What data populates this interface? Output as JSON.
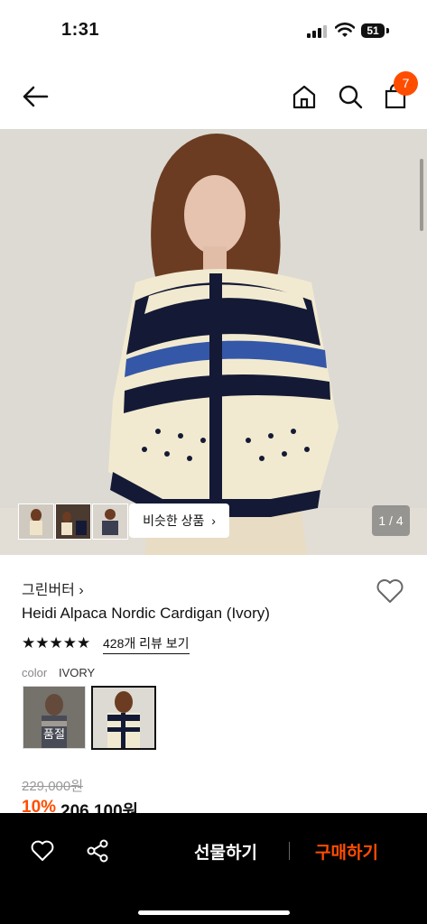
{
  "status_bar": {
    "time": "1:31",
    "battery": "51"
  },
  "header": {
    "cart_count": "7"
  },
  "gallery": {
    "similar_label": "비슷한 상품",
    "page_counter": "1 / 4"
  },
  "product": {
    "brand": "그린버터",
    "name": "Heidi Alpaca Nordic Cardigan (Ivory)",
    "rating_stars": 5,
    "review_link": "428개 리뷰 보기",
    "color_label": "color",
    "color_value": "IVORY",
    "options": [
      {
        "badge": "품절"
      }
    ],
    "original_price": "229,000원",
    "discount": "10%",
    "price": "206,100원"
  },
  "bottom_bar": {
    "gift_label": "선물하기",
    "buy_label": "구매하기"
  }
}
